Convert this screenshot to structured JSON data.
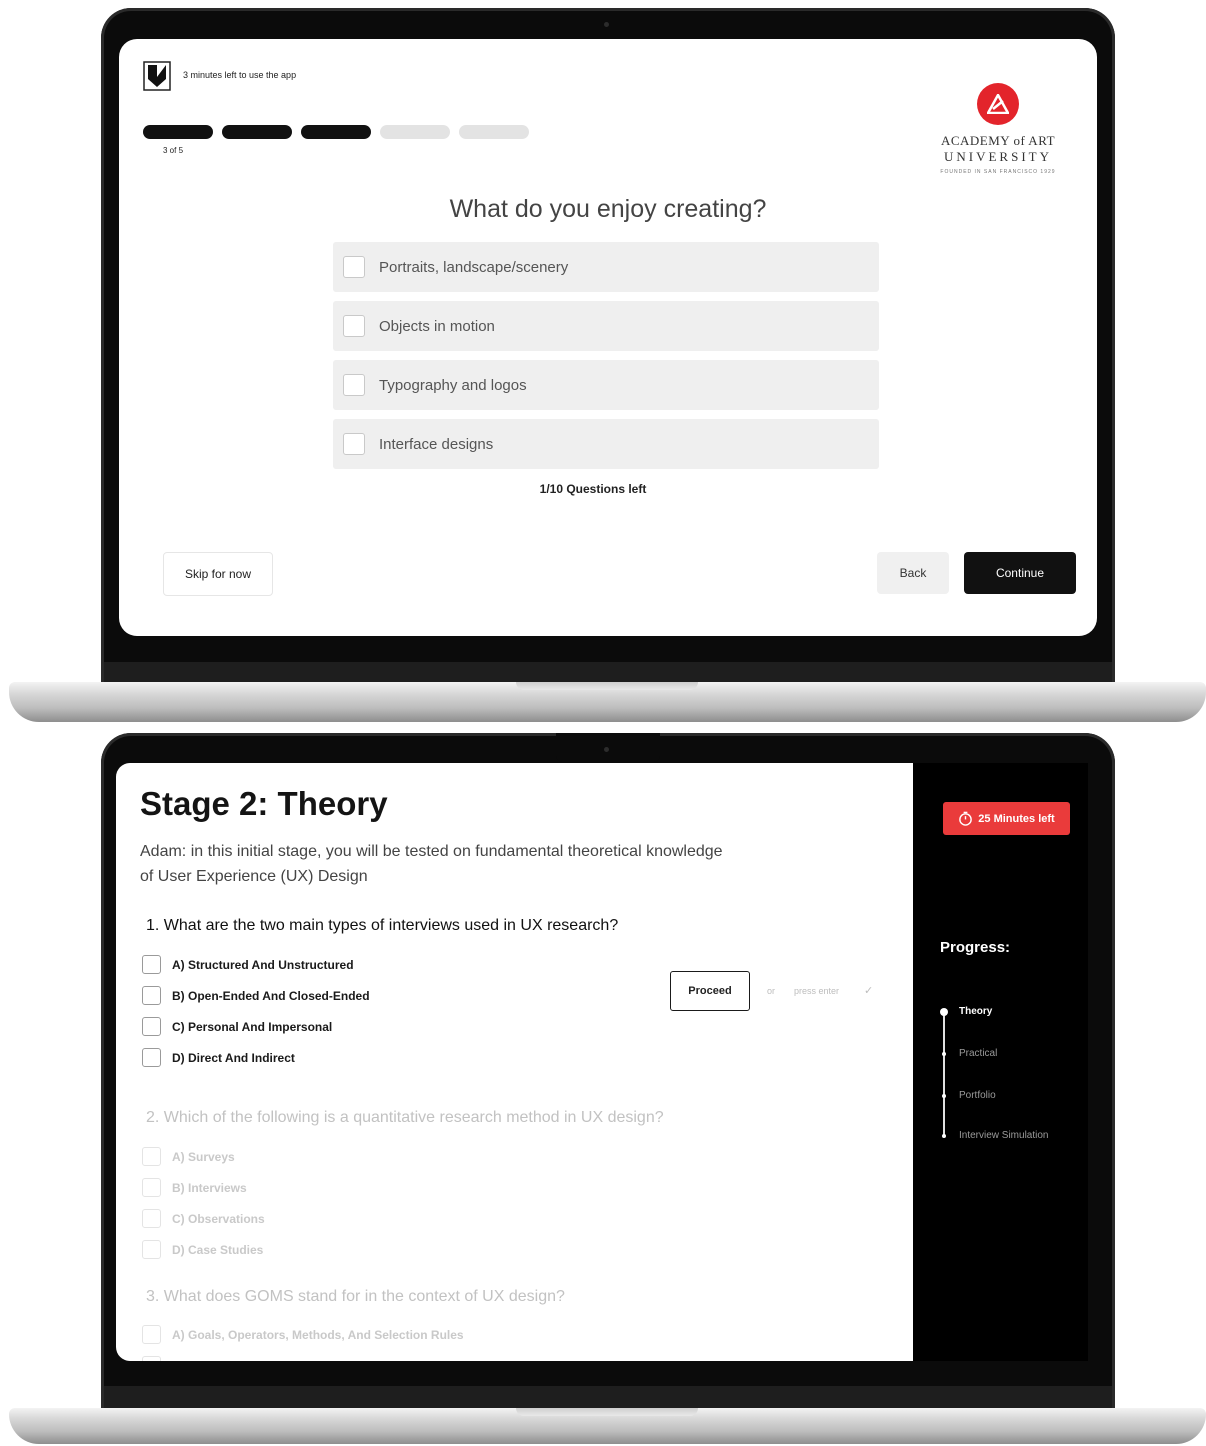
{
  "screen1": {
    "timer_text": "3 minutes left to use the app",
    "progress": {
      "label": "3 of 5",
      "completed": 3,
      "total": 5
    },
    "university": {
      "line1": "ACADEMY of ART",
      "line2": "UNIVERSITY",
      "line3": "FOUNDED IN SAN FRANCISCO 1929"
    },
    "question": "What do you enjoy creating?",
    "options": [
      "Portraits, landscape/scenery",
      "Objects in motion",
      "Typography and logos",
      "Interface designs"
    ],
    "questions_left": "1/10 Questions left",
    "skip_label": "Skip for now",
    "back_label": "Back",
    "continue_label": "Continue"
  },
  "screen2": {
    "title": "Stage 2: Theory",
    "description": "Adam: in this initial stage, you will be tested on fundamental theoretical knowledge of User Experience (UX) Design",
    "questions": [
      {
        "text": "1. What are the two main types of interviews used in UX research?",
        "options": [
          "A) Structured And Unstructured",
          "B) Open-Ended And Closed-Ended",
          "C) Personal And Impersonal",
          "D) Direct And Indirect"
        ]
      },
      {
        "text": "2. Which of the following is a quantitative research method in UX design?",
        "options": [
          "A) Surveys",
          "B) Interviews",
          "C) Observations",
          "D) Case Studies"
        ]
      },
      {
        "text": "3. What does GOMS stand for in the context of UX design?",
        "options": [
          "A) Goals, Operators, Methods, And Selection Rules"
        ]
      }
    ],
    "proceed_label": "Proceed",
    "or_text": "or",
    "press_enter_text": "press enter",
    "time_left": "25 Minutes left",
    "progress_title": "Progress:",
    "steps": [
      "Theory",
      "Practical",
      "Portfolio",
      "Interview Simulation"
    ]
  },
  "colors": {
    "accent_red": "#ea3b3b",
    "brand_red": "#e3242b",
    "dark": "#111111"
  }
}
